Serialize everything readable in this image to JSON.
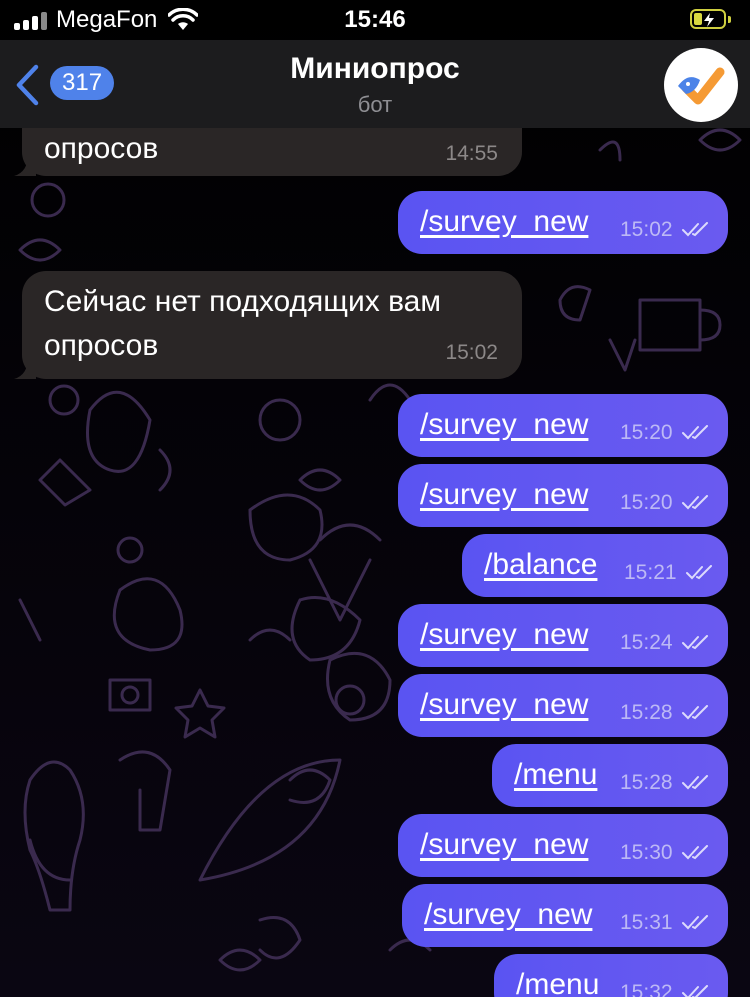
{
  "status_bar": {
    "carrier": "MegaFon",
    "time": "15:46"
  },
  "header": {
    "back_count": "317",
    "title": "Миниопрос",
    "subtitle": "бот"
  },
  "messages": [
    {
      "direction": "incoming",
      "lines": [
        "опросов"
      ],
      "time": "14:55"
    },
    {
      "direction": "outgoing",
      "text": "/survey_new",
      "time": "15:02",
      "status": "read"
    },
    {
      "direction": "incoming",
      "lines": [
        "Сейчас нет подходящих вам",
        "опросов"
      ],
      "time": "15:02"
    },
    {
      "direction": "outgoing",
      "text": "/survey_new",
      "time": "15:20",
      "status": "read"
    },
    {
      "direction": "outgoing",
      "text": "/survey_new",
      "time": "15:20",
      "status": "read"
    },
    {
      "direction": "outgoing",
      "text": "/balance",
      "time": "15:21",
      "status": "read"
    },
    {
      "direction": "outgoing",
      "text": "/survey_new",
      "time": "15:24",
      "status": "read"
    },
    {
      "direction": "outgoing",
      "text": "/survey_new",
      "time": "15:28",
      "status": "read"
    },
    {
      "direction": "outgoing",
      "text": "/menu",
      "time": "15:28",
      "status": "read"
    },
    {
      "direction": "outgoing",
      "text": "/survey_new",
      "time": "15:30",
      "status": "read"
    },
    {
      "direction": "outgoing",
      "text": "/survey_new",
      "time": "15:31",
      "status": "read"
    },
    {
      "direction": "outgoing",
      "text": "/menu",
      "time": "15:32",
      "status": "read"
    }
  ],
  "icons": {
    "back": "chevron-left-icon",
    "signal": "cellular-signal-icon",
    "wifi": "wifi-icon",
    "battery": "battery-charging-icon",
    "read": "double-check-icon",
    "avatar": "bird-checkmark-logo"
  },
  "colors": {
    "accent": "#4f82ea",
    "outgoing_bubble": "#5a54f2",
    "incoming_bubble": "#2a2626",
    "header_bg": "#1c1c1e"
  }
}
